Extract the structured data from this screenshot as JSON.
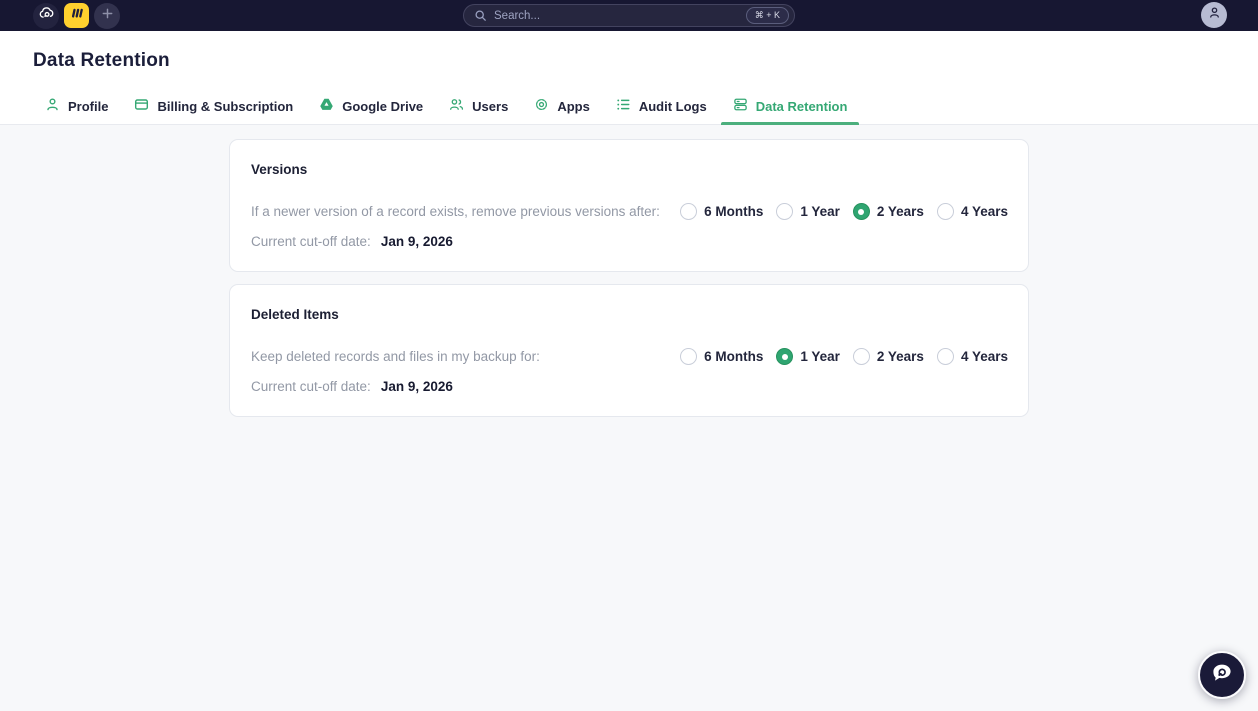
{
  "topbar": {
    "logos": [
      "cloud-backup-logo",
      "monday-logo",
      "add-workspace"
    ],
    "search": {
      "placeholder": "Search...",
      "shortcut": "⌘ + K"
    }
  },
  "header": {
    "title": "Data Retention"
  },
  "tabs": [
    {
      "label": "Profile",
      "icon": "person-icon",
      "active": false
    },
    {
      "label": "Billing & Subscription",
      "icon": "credit-card-icon",
      "active": false
    },
    {
      "label": "Google Drive",
      "icon": "google-drive-icon",
      "active": false
    },
    {
      "label": "Users",
      "icon": "users-icon",
      "active": false
    },
    {
      "label": "Apps",
      "icon": "gear-icon",
      "active": false
    },
    {
      "label": "Audit Logs",
      "icon": "list-icon",
      "active": false
    },
    {
      "label": "Data Retention",
      "icon": "server-icon",
      "active": true
    }
  ],
  "cards": [
    {
      "title": "Versions",
      "description": "If a newer version of a record exists, remove previous versions after:",
      "options": [
        "6 Months",
        "1 Year",
        "2 Years",
        "4 Years"
      ],
      "selected": "2 Years",
      "cutoff_label": "Current cut-off date:",
      "cutoff_date": "Jan 9, 2026"
    },
    {
      "title": "Deleted Items",
      "description": "Keep deleted records and files in my backup for:",
      "options": [
        "6 Months",
        "1 Year",
        "2 Years",
        "4 Years"
      ],
      "selected": "1 Year",
      "cutoff_label": "Current cut-off date:",
      "cutoff_date": "Jan 9, 2026"
    }
  ],
  "colors": {
    "accent_green": "#35a874",
    "radio_selected_green": "#2fa571",
    "topbar_bg": "#171732",
    "monday_yellow": "#ffd02e",
    "content_bg": "#f7f8fa"
  }
}
